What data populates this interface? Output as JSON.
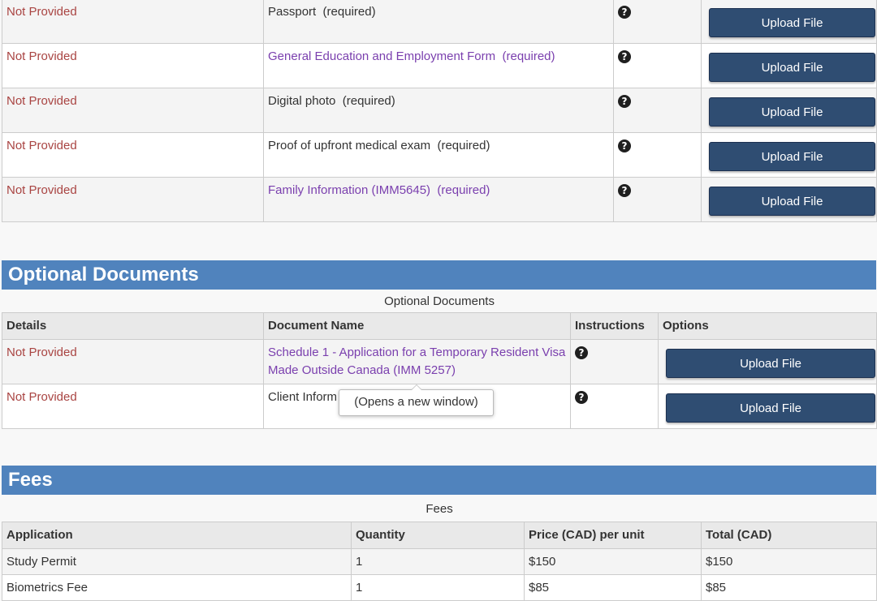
{
  "required_docs": {
    "rows": [
      {
        "status": "Not Provided",
        "name": "Passport",
        "req": "(required)",
        "is_link": false,
        "button": "Upload File"
      },
      {
        "status": "Not Provided",
        "name": "General Education and Employment Form",
        "req": "(required)",
        "is_link": true,
        "button": "Upload File"
      },
      {
        "status": "Not Provided",
        "name": "Digital photo",
        "req": "(required)",
        "is_link": false,
        "button": "Upload File"
      },
      {
        "status": "Not Provided",
        "name": "Proof of upfront medical exam",
        "req": "(required)",
        "is_link": false,
        "button": "Upload File"
      },
      {
        "status": "Not Provided",
        "name": "Family Information (IMM5645)",
        "req": "(required)",
        "is_link": true,
        "button": "Upload File"
      }
    ]
  },
  "optional_docs": {
    "header": "Optional Documents",
    "caption": "Optional Documents",
    "columns": [
      "Details",
      "Document Name",
      "Instructions",
      "Options"
    ],
    "rows": [
      {
        "status": "Not Provided",
        "name": "Schedule 1 - Application for a Temporary Resident Visa Made Outside Canada (IMM 5257)",
        "button": "Upload File"
      },
      {
        "status": "Not Provided",
        "name": "Client Inform",
        "button": "Upload File"
      }
    ]
  },
  "tooltip": "(Opens a new window)",
  "fees": {
    "header": "Fees",
    "caption": "Fees",
    "columns": [
      "Application",
      "Quantity",
      "Price (CAD) per unit",
      "Total (CAD)"
    ],
    "rows": [
      {
        "application": "Study Permit",
        "quantity": "1",
        "price": "$150",
        "total": "$150"
      },
      {
        "application": "Biometrics Fee",
        "quantity": "1",
        "price": "$85",
        "total": "$85"
      }
    ]
  },
  "icons": {
    "help": "question-circle-icon"
  },
  "colors": {
    "section_header": "#5083bd",
    "button": "#2f4d72",
    "status": "#a94442",
    "link": "#7a3fae"
  }
}
